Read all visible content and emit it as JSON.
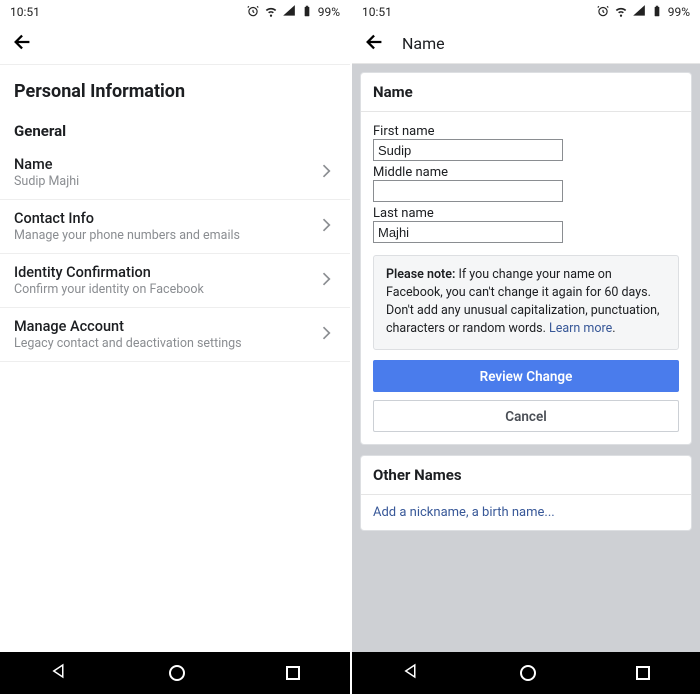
{
  "status": {
    "time": "10:51",
    "battery": "99%"
  },
  "left": {
    "page_title": "Personal Information",
    "section": "General",
    "rows": [
      {
        "label": "Name",
        "sub": "Sudip Majhi"
      },
      {
        "label": "Contact Info",
        "sub": "Manage your phone numbers and emails"
      },
      {
        "label": "Identity Confirmation",
        "sub": "Confirm your identity on Facebook"
      },
      {
        "label": "Manage Account",
        "sub": "Legacy contact and deactivation settings"
      }
    ]
  },
  "right": {
    "appbar_title": "Name",
    "card_title": "Name",
    "first_label": "First name",
    "first_value": "Sudip",
    "middle_label": "Middle name",
    "middle_value": "",
    "last_label": "Last name",
    "last_value": "Majhi",
    "notice_prefix": "Please note:",
    "notice_text": " If you change your name on Facebook, you can't change it again for 60 days. Don't add any unusual capitalization, punctuation, characters or random words. ",
    "notice_link": "Learn more",
    "review_btn": "Review Change",
    "cancel_btn": "Cancel",
    "other_title": "Other Names",
    "other_link": "Add a nickname, a birth name..."
  }
}
